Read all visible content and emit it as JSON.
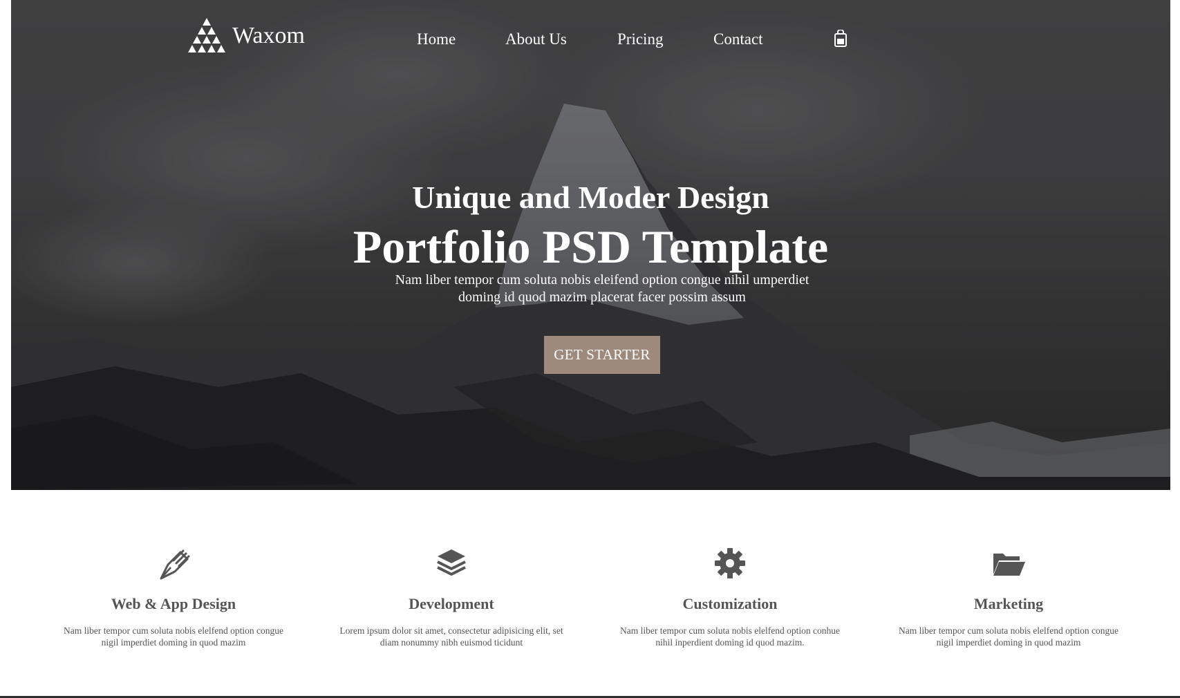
{
  "brand": {
    "name": "Waxom",
    "logo_icon": "triangle-logo-icon"
  },
  "nav": {
    "items": [
      {
        "label": "Home"
      },
      {
        "label": "About Us"
      },
      {
        "label": "Pricing"
      },
      {
        "label": "Contact"
      }
    ],
    "cart_icon": "shopping-bag-icon"
  },
  "hero": {
    "subtitle": "Unique and Moder Design",
    "title": "Portfolio PSD Template",
    "description_line1": "Nam liber tempor cum soluta nobis eleifend option congue nihil umperdiet",
    "description_line2": "doming id quod mazim placerat facer possim assum",
    "cta_label": "GET STARTER",
    "cta_color": "#9e8a7d"
  },
  "features": [
    {
      "icon": "pen-nib-icon",
      "title": "Web & App Design",
      "line1": "Nam liber tempor cum soluta nobis elelfend option congue",
      "line2": "nigil imperdiet doming in quod mazim"
    },
    {
      "icon": "layers-icon",
      "title": "Development",
      "line1": "Lorem ipsum dolor sit amet, consectetur adipisicing elit, set",
      "line2": "diam nonummy nibh euismod ticidunt"
    },
    {
      "icon": "gear-icon",
      "title": "Customization",
      "line1": "Nam liber tempor cum soluta nobis elelfend option conhue",
      "line2": "nihil inperdient doming id quod mazim."
    },
    {
      "icon": "folder-open-icon",
      "title": "Marketing",
      "line1": "Nam liber tempor cum soluta nobis elelfend option congue",
      "line2": "nigil imperdiet doming in quod mazim"
    }
  ]
}
